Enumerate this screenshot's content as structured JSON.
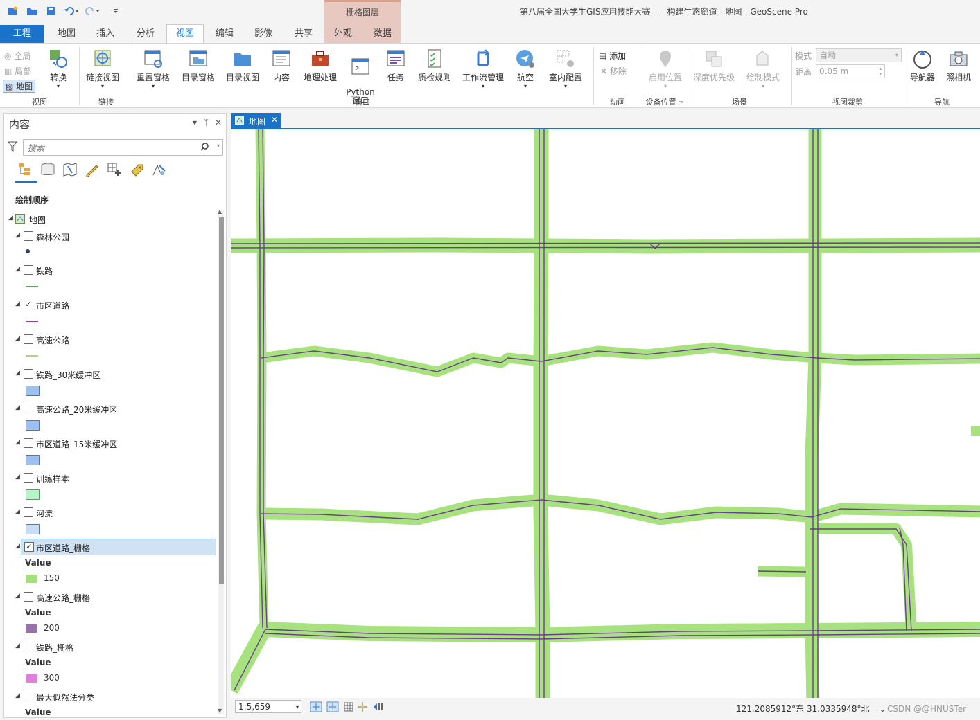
{
  "window": {
    "title": "第八届全国大学生GIS应用技能大赛——构建生态廊道 - 地图 - GeoScene Pro",
    "contextual_tab_group": "栅格图层"
  },
  "tabs": [
    "工程",
    "地图",
    "插入",
    "分析",
    "视图",
    "编辑",
    "影像",
    "共享",
    "外观",
    "数据"
  ],
  "active_tab": "视图",
  "ribbon": {
    "view_group": {
      "full": "全局",
      "local": "局部",
      "map": "地图",
      "convert": "转换",
      "label": "视图"
    },
    "link_group": {
      "link_views": "链接视图",
      "label": "链接"
    },
    "window_group": {
      "reset_panes": "重置窗格",
      "catalog_pane": "目录窗格",
      "catalog_view": "目录视图",
      "contents": "内容",
      "geoprocessing": "地理处理",
      "python_window": "Python\n窗口",
      "tasks": "任务",
      "qc_rules": "质检规则",
      "workflow_mgmt": "工作流管理",
      "aviation": "航空",
      "indoor_config": "室内配置",
      "label": "窗口"
    },
    "animation_group": {
      "add": "添加",
      "remove": "移除",
      "label": "动画"
    },
    "device_group": {
      "enable_location": "启用位置",
      "label": "设备位置"
    },
    "scene_group": {
      "depth_priority": "深度优先级",
      "draw_mode": "绘制模式",
      "label": "场景"
    },
    "clip_group": {
      "mode_label": "模式",
      "mode_value": "自动",
      "distance_label": "距离",
      "distance_value": "0.05  m",
      "label": "视图裁剪"
    },
    "nav_group": {
      "navigator": "导航器",
      "camera": "照相机",
      "label": "导航"
    }
  },
  "contents_pane": {
    "title": "内容",
    "search_placeholder": "搜索",
    "draw_order": "绘制顺序",
    "map_name": "地图",
    "layers": [
      {
        "name": "森林公园",
        "checked": false
      },
      {
        "name": "铁路",
        "checked": false
      },
      {
        "name": "市区道路",
        "checked": true
      },
      {
        "name": "高速公路",
        "checked": false
      },
      {
        "name": "铁路_30米缓冲区",
        "checked": false
      },
      {
        "name": "高速公路_20米缓冲区",
        "checked": false
      },
      {
        "name": "市区道路_15米缓冲区",
        "checked": false
      },
      {
        "name": "训练样本",
        "checked": false
      },
      {
        "name": "河流",
        "checked": false
      },
      {
        "name": "市区道路_栅格",
        "checked": true
      },
      {
        "name": "高速公路_栅格",
        "checked": false
      },
      {
        "name": "铁路_栅格",
        "checked": false
      },
      {
        "name": "最大似然法分类",
        "checked": false
      }
    ],
    "value_header": "Value",
    "raster_values": {
      "road": "150",
      "highway": "200",
      "railway": "300"
    },
    "colors": {
      "road_raster": "#a3e07c",
      "highway_raster": "#9a6fae",
      "railway_raster": "#e07ee0",
      "buffer": "#9ec0f0",
      "training": "#b6f5c8",
      "river": "#c6dcf7",
      "forest_dot": "#2a3a5c",
      "railway_line": "#5c9e5c",
      "road_line": "#9a3fa0",
      "highway_line": "#b4d27a"
    }
  },
  "map_view": {
    "tab_label": "地图",
    "scale": "1:5,659",
    "coordinates": "121.2085912°东 31.0335948°北",
    "watermark": "CSDN @@HNUSTer",
    "colors": {
      "corridor": "#a8e27e",
      "road": "#6b3d8f"
    }
  }
}
